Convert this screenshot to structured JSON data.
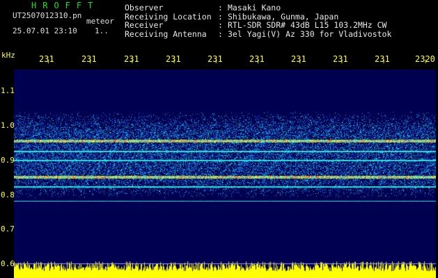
{
  "header": {
    "brand": "HROFFT",
    "filename": "UT2507012310.pn",
    "mode": "meteor",
    "datetime": "25.07.01 23:10",
    "extra": "1..",
    "rows": [
      {
        "label": "Observer",
        "value": "Masaki Kano"
      },
      {
        "label": "Receiving Location",
        "value": "Shibukawa, Gunma, Japan"
      },
      {
        "label": "Receiver",
        "value": "RTL-SDR SDR# 43dB L15 103.2MHz CW"
      },
      {
        "label": "Receiving Antenna",
        "value": "3el Yagi(V) Az 330 for Vladivostok"
      }
    ]
  },
  "time_axis": {
    "labels": [
      "231",
      "231",
      "231",
      "231",
      "231",
      "231",
      "231",
      "231",
      "231",
      "2320"
    ]
  },
  "freq_axis": {
    "unit": "kHz",
    "labels": [
      "1.1",
      "1.0",
      "0.9",
      "0.8",
      "0.7",
      "0.6"
    ]
  },
  "colors": {
    "brand": "#19e619",
    "text": "#e8e8e8",
    "axis": "#ffff33",
    "background": "#000000",
    "plot_bg": "#000050"
  }
}
